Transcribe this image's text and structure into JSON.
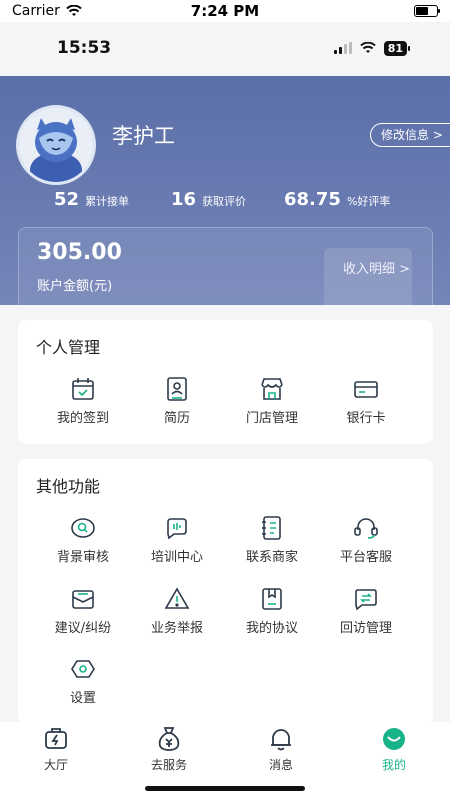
{
  "ios_status": {
    "carrier": "Carrier",
    "time": "7:24 PM"
  },
  "app_status": {
    "time": "15:53",
    "battery": "81"
  },
  "profile": {
    "name": "李护工",
    "edit_label": "修改信息 >"
  },
  "stats": [
    {
      "value": "52",
      "label": "累计接单"
    },
    {
      "value": "16",
      "label": "获取评价"
    },
    {
      "value": "68.75",
      "label": "%好评率"
    }
  ],
  "balance": {
    "amount": "305.00",
    "label": "账户金额(元)",
    "detail_link": "收入明细 >"
  },
  "personal": {
    "title": "个人管理",
    "items": [
      {
        "label": "我的签到",
        "icon": "calendar-check-icon"
      },
      {
        "label": "简历",
        "icon": "resume-icon"
      },
      {
        "label": "门店管理",
        "icon": "store-icon"
      },
      {
        "label": "银行卡",
        "icon": "bank-card-icon"
      }
    ]
  },
  "other": {
    "title": "其他功能",
    "items": [
      {
        "label": "背景审核",
        "icon": "background-check-icon"
      },
      {
        "label": "培训中心",
        "icon": "training-icon"
      },
      {
        "label": "联系商家",
        "icon": "contact-book-icon"
      },
      {
        "label": "平台客服",
        "icon": "headset-icon"
      },
      {
        "label": "建议/纠纷",
        "icon": "suggestion-icon"
      },
      {
        "label": "业务举报",
        "icon": "warning-icon"
      },
      {
        "label": "我的协议",
        "icon": "agreement-icon"
      },
      {
        "label": "回访管理",
        "icon": "callback-icon"
      },
      {
        "label": "设置",
        "icon": "settings-icon"
      }
    ]
  },
  "tabs": [
    {
      "label": "大厅",
      "icon": "hall-icon"
    },
    {
      "label": "去服务",
      "icon": "service-icon"
    },
    {
      "label": "消息",
      "icon": "bell-icon"
    },
    {
      "label": "我的",
      "icon": "me-icon",
      "active": true
    }
  ],
  "colors": {
    "header": "#5b6ea8",
    "accent": "#19b38a",
    "icon_stroke": "#2d3a4a"
  }
}
